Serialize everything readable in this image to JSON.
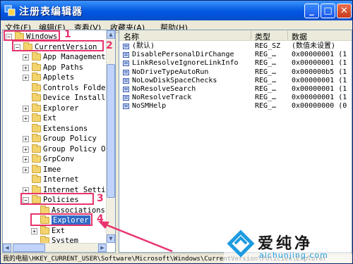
{
  "window": {
    "title": "注册表编辑器"
  },
  "menu": [
    {
      "label": "文件(F)"
    },
    {
      "label": "编辑(E)"
    },
    {
      "label": "查看(V)"
    },
    {
      "label": "收藏夹(A)"
    },
    {
      "label": "帮助(H)"
    }
  ],
  "tree": [
    {
      "label": "Windows",
      "indent": 0,
      "expander": "-"
    },
    {
      "label": "CurrentVersion",
      "indent": 1,
      "expander": "-"
    },
    {
      "label": "App Management",
      "indent": 2,
      "expander": "+"
    },
    {
      "label": "App Paths",
      "indent": 2,
      "expander": "+"
    },
    {
      "label": "Applets",
      "indent": 2,
      "expander": "+"
    },
    {
      "label": "Controls Folde:",
      "indent": 2,
      "expander": ""
    },
    {
      "label": "Device Installe",
      "indent": 2,
      "expander": ""
    },
    {
      "label": "Explorer",
      "indent": 2,
      "expander": "+"
    },
    {
      "label": "Ext",
      "indent": 2,
      "expander": "+"
    },
    {
      "label": "Extensions",
      "indent": 2,
      "expander": ""
    },
    {
      "label": "Group Policy",
      "indent": 2,
      "expander": "+"
    },
    {
      "label": "Group Policy Ol",
      "indent": 2,
      "expander": "+"
    },
    {
      "label": "GrpConv",
      "indent": 2,
      "expander": "+"
    },
    {
      "label": "Imee",
      "indent": 2,
      "expander": "+"
    },
    {
      "label": "Internet",
      "indent": 2,
      "expander": ""
    },
    {
      "label": "Internet Settin",
      "indent": 2,
      "expander": "+"
    },
    {
      "label": "Policies",
      "indent": 2,
      "expander": "-"
    },
    {
      "label": "Associations",
      "indent": 3,
      "expander": ""
    },
    {
      "label": "Explorer",
      "indent": 3,
      "expander": "",
      "selected": true
    },
    {
      "label": "Ext",
      "indent": 3,
      "expander": "+"
    },
    {
      "label": "System",
      "indent": 3,
      "expander": ""
    }
  ],
  "list": {
    "headers": {
      "name": "名称",
      "type": "类型",
      "data": "数据"
    },
    "rows": [
      {
        "name": "(默认)",
        "type": "REG_SZ",
        "data": "(数值未设置)"
      },
      {
        "name": "DisablePersonalDirChange",
        "type": "REG_…",
        "data": "0x00000001 (1"
      },
      {
        "name": "LinkResolveIgnoreLinkInfo",
        "type": "REG_…",
        "data": "0x00000001 (1"
      },
      {
        "name": "NoDriveTypeAutoRun",
        "type": "REG_…",
        "data": "0x000000b5 (1"
      },
      {
        "name": "NoLowDiskSpaceChecks",
        "type": "REG_…",
        "data": "0x00000001 (1"
      },
      {
        "name": "NoResolveSearch",
        "type": "REG_…",
        "data": "0x00000001 (1"
      },
      {
        "name": "NoResolveTrack",
        "type": "REG_…",
        "data": "0x00000001 (1"
      },
      {
        "name": "NoSMHelp",
        "type": "REG_…",
        "data": "0x00000000 (0"
      }
    ]
  },
  "annotations": [
    "1",
    "2",
    "3",
    "4"
  ],
  "statusbar": {
    "path": "我的电脑\\HKEY_CURRENT_USER\\Software\\Microsoft\\Windows\\CurrentVersion\\Policies\\Explorer"
  },
  "watermark": {
    "text": "爱纯净",
    "url": "aichunjing.com"
  },
  "colors": {
    "titlebar": "#0054e3",
    "highlight": "#e8336b",
    "selection": "#316ac5"
  }
}
